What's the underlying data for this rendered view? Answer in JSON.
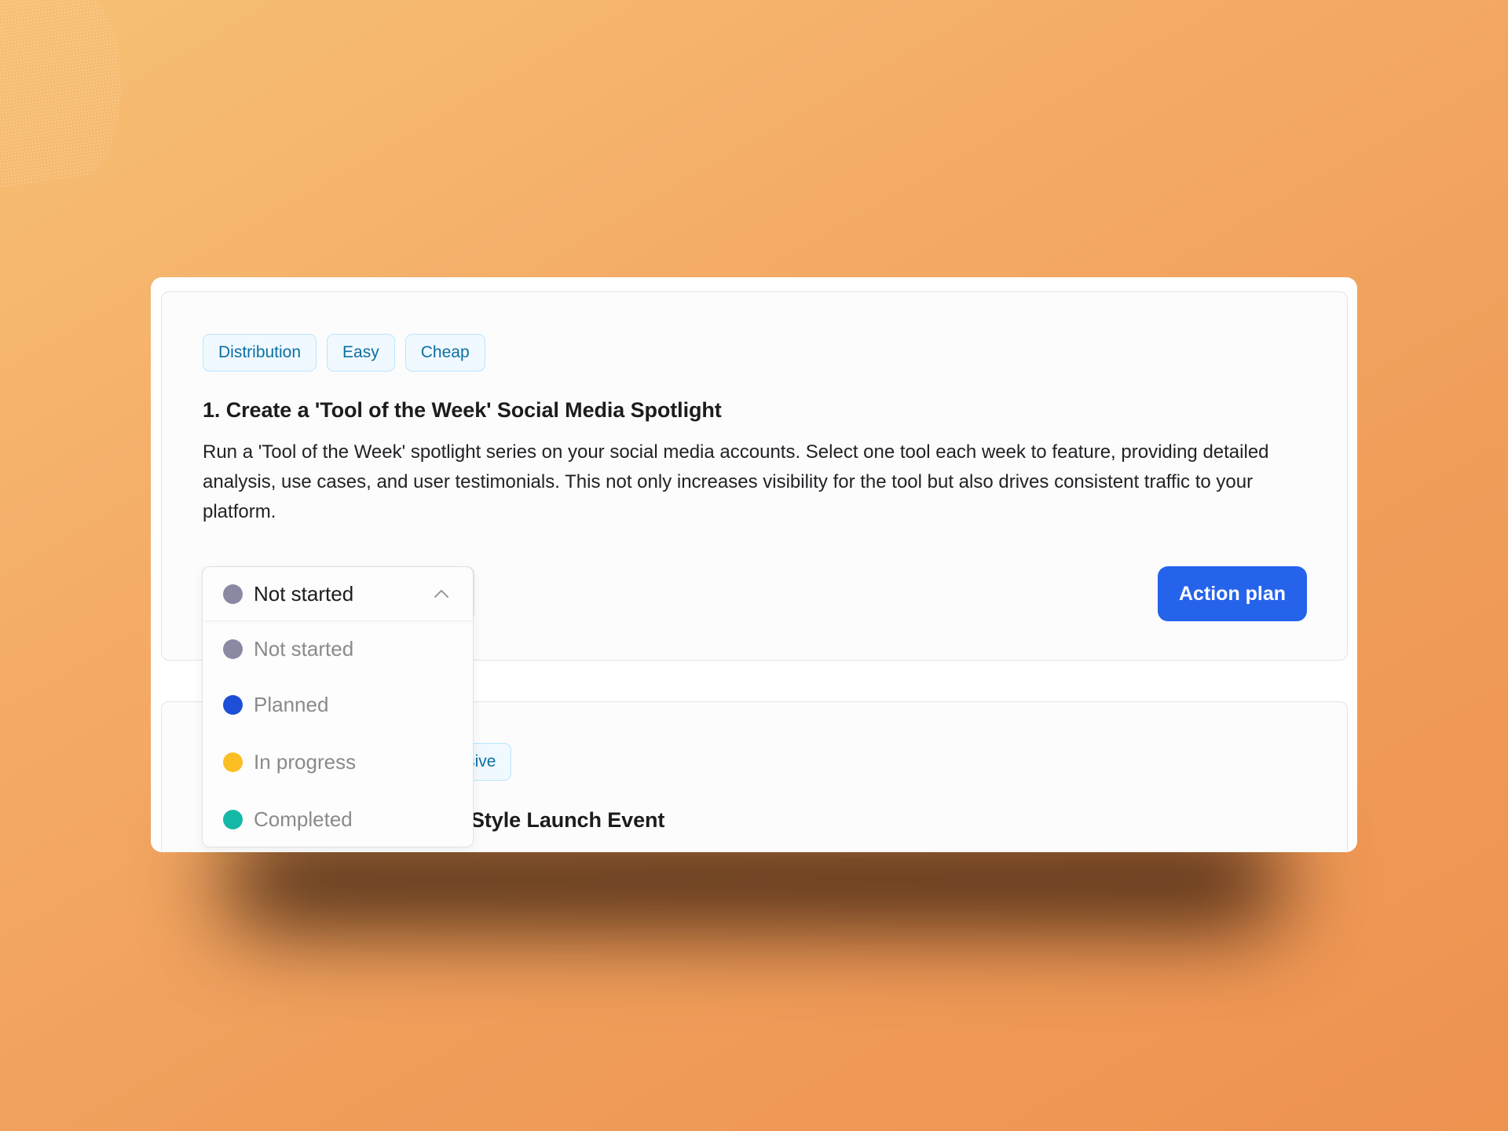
{
  "colors": {
    "accent": "#2563EB",
    "tag_text": "#0B6FA4",
    "tag_bg": "#F0F9FF",
    "tag_border": "#BAE6FD"
  },
  "cards": [
    {
      "tags": [
        "Distribution",
        "Easy",
        "Cheap"
      ],
      "title": "1. Create a 'Tool of the Week' Social Media Spotlight",
      "description": "Run a 'Tool of the Week' spotlight series on your social media accounts. Select one tool each week to feature, providing detailed analysis, use cases, and user testimonials. This not only increases visibility for the tool but also drives consistent traffic to your platform.",
      "action_label": "Action plan"
    },
    {
      "tags": [
        "Expensive"
      ],
      "title_visible": "Style Launch Event"
    }
  ],
  "status_dropdown": {
    "selected": {
      "label": "Not started",
      "color": "#8A89A3"
    },
    "expanded": true,
    "chevron": "chevron-up-icon",
    "options": [
      {
        "label": "Not started",
        "color": "#8A89A3"
      },
      {
        "label": "Planned",
        "color": "#1D4ED8"
      },
      {
        "label": "In progress",
        "color": "#FBBF24"
      },
      {
        "label": "Completed",
        "color": "#14B8A6"
      }
    ]
  }
}
